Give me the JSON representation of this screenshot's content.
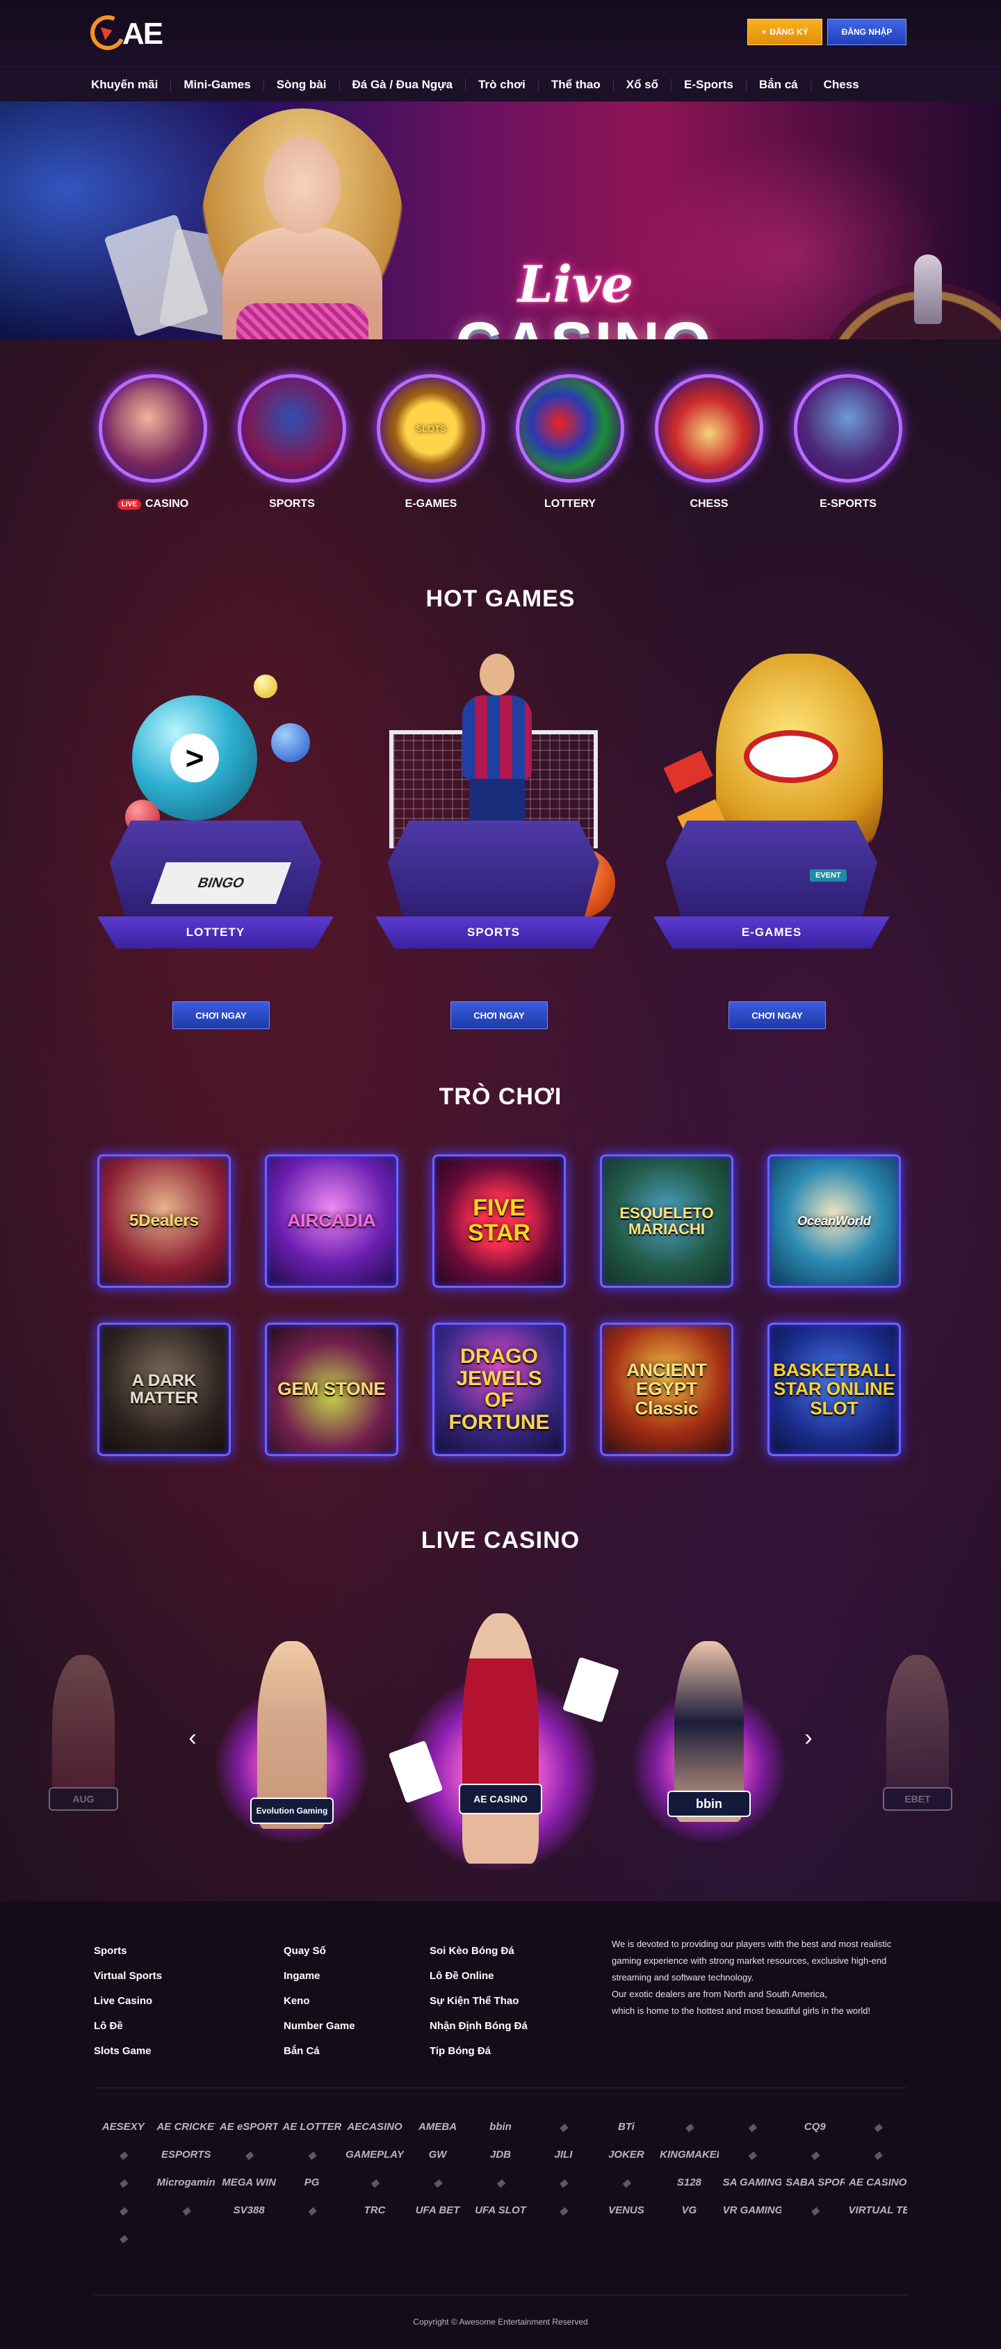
{
  "header": {
    "logo_text": "AE",
    "register_label": "ĐĂNG KÝ",
    "register_icon": "plus-icon",
    "login_label": "ĐĂNG NHẬP"
  },
  "nav": {
    "items": [
      "Khuyến mãi",
      "Mini-Games",
      "Sòng bài",
      "Đá Gà / Đua Ngựa",
      "Trò chơi",
      "Thể thao",
      "Xổ số",
      "E-Sports",
      "Bắn cá",
      "Chess"
    ]
  },
  "banner": {
    "title_script": "Live",
    "title_main": "CASINO"
  },
  "categories": {
    "live_badge": "LIVE",
    "items": [
      {
        "label": "CASINO",
        "art": ""
      },
      {
        "label": "SPORTS",
        "art": ""
      },
      {
        "label": "E-GAMES",
        "art": "SLOTS"
      },
      {
        "label": "LOTTERY",
        "art": ""
      },
      {
        "label": "CHESS",
        "art": ""
      },
      {
        "label": "E-SPORTS",
        "art": ""
      }
    ]
  },
  "hot_games": {
    "title": "HOT GAMES",
    "items": [
      {
        "label": "LOTTETY",
        "button": "CHƠI NGAY",
        "art": "BINGO"
      },
      {
        "label": "SPORTS",
        "button": "CHƠI NGAY",
        "art": ""
      },
      {
        "label": "E-GAMES",
        "button": "CHƠI NGAY",
        "art": "EVENT"
      }
    ]
  },
  "games": {
    "title": "TRÒ CHƠI",
    "items": [
      "5Dealers",
      "AIRCADIA",
      "FIVE STAR",
      "ESQUELETO MARIACHI",
      "OceanWorld",
      "A DARK MATTER",
      "GEM STONE",
      "DRAGO JEWELS OF FORTUNE",
      "ANCIENT EGYPT Classic",
      "BASKETBALL STAR ONLINE SLOT"
    ]
  },
  "live_casino": {
    "title": "LIVE CASINO",
    "prev_icon": "chevron-left-icon",
    "next_icon": "chevron-right-icon",
    "providers": [
      "AUG",
      "Evolution Gaming",
      "AE CASINO",
      "bbin",
      "EBET"
    ]
  },
  "footer": {
    "col1": [
      "Sports",
      "Virtual Sports",
      "Live Casino",
      "Lô Đề",
      "Slots Game"
    ],
    "col2": [
      "Quay Số",
      "Ingame",
      "Keno",
      "Number Game",
      "Bắn Cá"
    ],
    "col3": [
      "Soi Kèo Bóng Đá",
      "Lô Đề Online",
      "Sự Kiện Thể Thao",
      "Nhận Định Bóng Đá",
      "Tip Bóng Đá"
    ],
    "about_line1": "We is devoted to providing our players with the best and most realistic gaming experience with strong market resources, exclusive high-end streaming and software technology.",
    "about_line2": "Our exotic dealers are from North and South America,",
    "about_line3": "which is home to the hottest and most beautiful girls in the world!",
    "partners": [
      "AESEXY",
      "AE CRICKET",
      "AE eSPORTS",
      "AE LOTTERY",
      "AECASINO",
      "AMEBA",
      "bbin",
      "",
      "BTi",
      "",
      "",
      "CQ9",
      "",
      "",
      "ESPORTS",
      "",
      "",
      "GAMEPLAY",
      "GW",
      "JDB",
      "JILI",
      "JOKER",
      "KINGMAKER",
      "",
      "",
      "",
      "",
      "Microgaming",
      "MEGA WIN",
      "PG",
      "",
      "",
      "",
      "",
      "",
      "S128",
      "SA GAMING",
      "SABA SPORTS",
      "AE CASINO",
      "",
      "",
      "SV388",
      "",
      "TRC",
      "UFA BET",
      "UFA SLOT",
      "",
      "VENUS",
      "VG",
      "VR GAMING",
      "",
      "VIRTUAL TECH",
      ""
    ],
    "copyright": "Copyright © Awesome Entertainment Reserved"
  }
}
